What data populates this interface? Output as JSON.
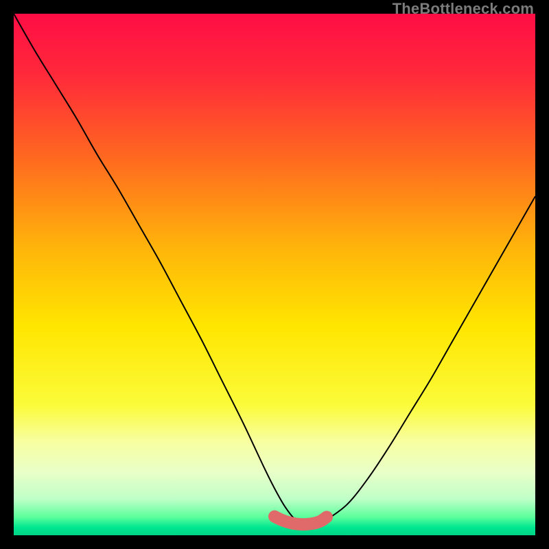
{
  "watermark": "TheBottleneck.com",
  "colors": {
    "black": "#000000",
    "curve": "#000000",
    "marker": "#e06a6a"
  },
  "chart_data": {
    "type": "line",
    "title": "",
    "xlabel": "",
    "ylabel": "",
    "xlim": [
      0,
      100
    ],
    "ylim": [
      0,
      100
    ],
    "gradient_stops": [
      {
        "offset": 0.0,
        "color": "#ff0d45"
      },
      {
        "offset": 0.12,
        "color": "#ff2a3a"
      },
      {
        "offset": 0.28,
        "color": "#ff6a1f"
      },
      {
        "offset": 0.45,
        "color": "#ffb50a"
      },
      {
        "offset": 0.6,
        "color": "#ffe600"
      },
      {
        "offset": 0.75,
        "color": "#fbfb3a"
      },
      {
        "offset": 0.82,
        "color": "#f8ffa0"
      },
      {
        "offset": 0.88,
        "color": "#e8ffc8"
      },
      {
        "offset": 0.93,
        "color": "#c0ffc8"
      },
      {
        "offset": 0.965,
        "color": "#5cff9c"
      },
      {
        "offset": 0.985,
        "color": "#00e690"
      },
      {
        "offset": 1.0,
        "color": "#00d486"
      }
    ],
    "series": [
      {
        "name": "bottleneck-curve",
        "x": [
          0,
          4,
          8,
          12,
          16,
          20,
          24,
          28,
          32,
          36,
          40,
          44,
          48,
          50,
          52,
          54,
          56,
          58,
          60,
          64,
          68,
          72,
          76,
          80,
          84,
          88,
          92,
          96,
          100
        ],
        "y": [
          100,
          93,
          86.5,
          80,
          73,
          66.5,
          59.5,
          52.5,
          45,
          37.5,
          29.5,
          21.5,
          13,
          9,
          5.5,
          3,
          2,
          2,
          3,
          6,
          11,
          17,
          23.5,
          30,
          37,
          44,
          51,
          58,
          65
        ]
      },
      {
        "name": "optimal-marker",
        "x": [
          50,
          51,
          52,
          53,
          54,
          55,
          56,
          57,
          58,
          59,
          60
        ],
        "y": [
          3.6,
          3.1,
          2.7,
          2.4,
          2.2,
          2.1,
          2.1,
          2.2,
          2.4,
          2.8,
          3.5
        ]
      }
    ]
  }
}
